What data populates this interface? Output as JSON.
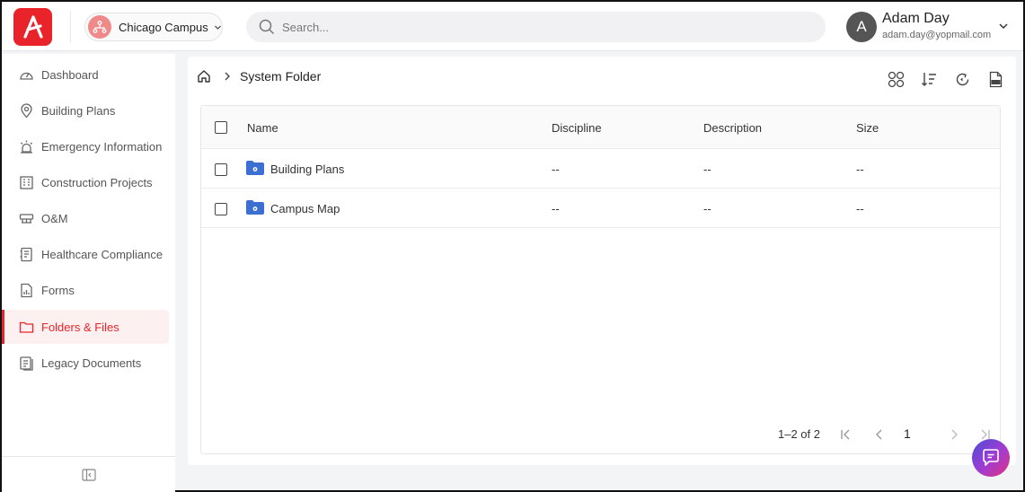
{
  "header": {
    "campus": {
      "name": "Chicago Campus"
    },
    "search": {
      "placeholder": "Search..."
    },
    "user": {
      "initial": "A",
      "name": "Adam Day",
      "email": "adam.day@yopmail.com"
    }
  },
  "sidebar": {
    "items": [
      {
        "label": "Dashboard",
        "icon": "gauge-icon"
      },
      {
        "label": "Building Plans",
        "icon": "map-pin-icon"
      },
      {
        "label": "Emergency Information",
        "icon": "siren-icon"
      },
      {
        "label": "Construction Projects",
        "icon": "building-icon"
      },
      {
        "label": "O&M",
        "icon": "equipment-icon"
      },
      {
        "label": "Healthcare Compliance",
        "icon": "notebook-icon"
      },
      {
        "label": "Forms",
        "icon": "form-icon"
      },
      {
        "label": "Folders & Files",
        "icon": "folder-icon",
        "active": true
      },
      {
        "label": "Legacy Documents",
        "icon": "documents-icon"
      }
    ]
  },
  "breadcrumb": {
    "current": "System Folder"
  },
  "table": {
    "columns": [
      "Name",
      "Discipline",
      "Description",
      "Size"
    ],
    "rows": [
      {
        "name": "Building Plans",
        "discipline": "--",
        "description": "--",
        "size": "--"
      },
      {
        "name": "Campus Map",
        "discipline": "--",
        "description": "--",
        "size": "--"
      }
    ]
  },
  "pagination": {
    "range": "1–2 of 2",
    "page": "1"
  },
  "colors": {
    "accent": "#e8242a",
    "folder": "#3b6fd1",
    "active_bg": "#fdf0f0"
  }
}
